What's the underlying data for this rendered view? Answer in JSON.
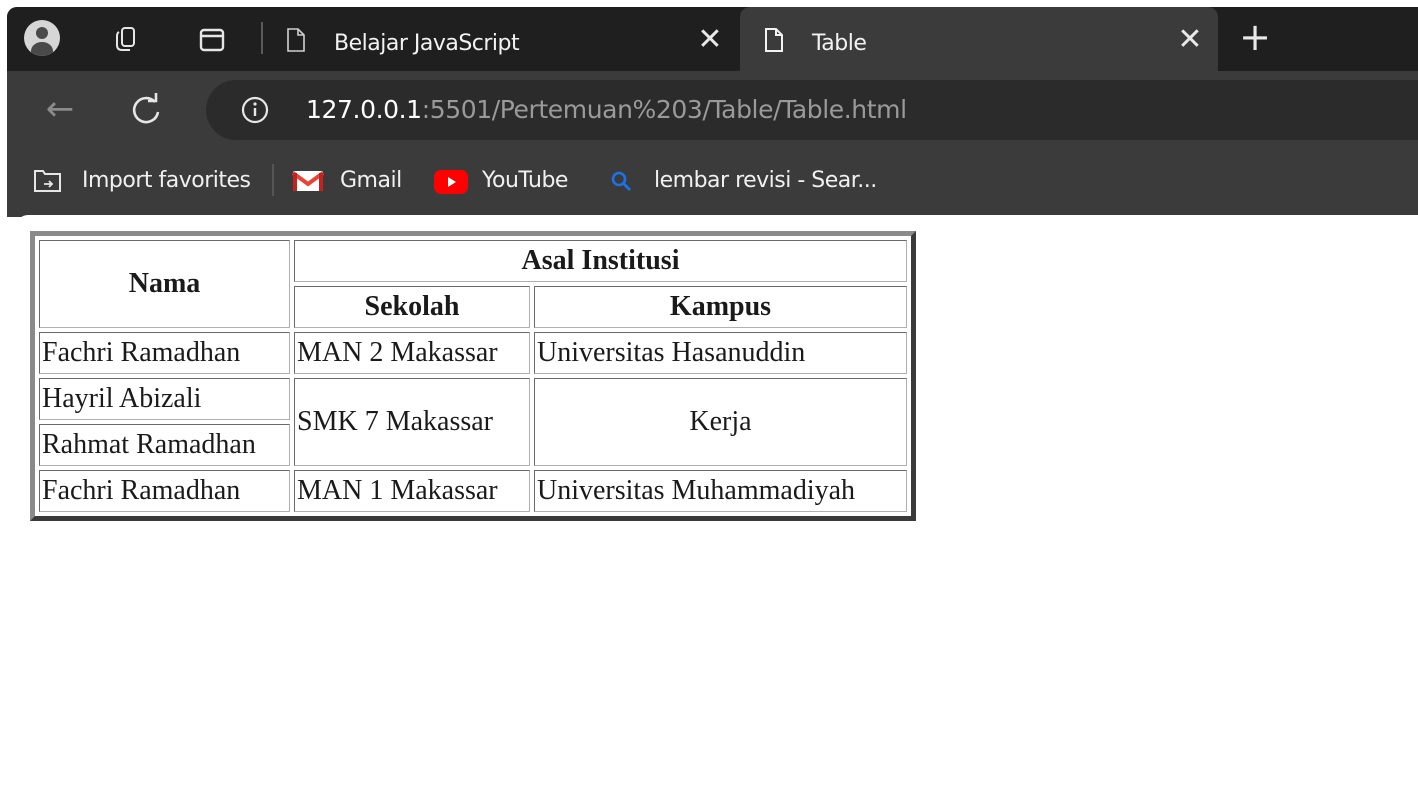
{
  "browser": {
    "tabs": [
      {
        "title": "Belajar JavaScript",
        "active": false
      },
      {
        "title": "Table",
        "active": true
      }
    ],
    "new_tab_symbol": "+",
    "close_symbol": "✕",
    "address": {
      "host": "127.0.0.1",
      "rest": ":5501/Pertemuan%203/Table/Table.html"
    },
    "favorites": [
      {
        "label": "Import favorites",
        "icon": "import-favorites-icon"
      },
      {
        "label": "Gmail",
        "icon": "gmail-icon"
      },
      {
        "label": "YouTube",
        "icon": "youtube-icon"
      },
      {
        "label": "lembar revisi - Sear...",
        "icon": "search-icon"
      }
    ],
    "colors": {
      "tabstrip": "#1f1f1f",
      "toolbar": "#3b3b3b",
      "address_bg": "#2b2b2b",
      "gmail_red": "#ea4335",
      "youtube_red": "#ff0000",
      "search_blue": "#1a73e8"
    }
  },
  "table": {
    "headers": {
      "nama": "Nama",
      "asal_institusi": "Asal Institusi",
      "sekolah": "Sekolah",
      "kampus": "Kampus"
    },
    "rows": [
      {
        "nama": "Fachri Ramadhan",
        "sekolah": "MAN 2 Makassar",
        "kampus": "Universitas Hasanuddin"
      },
      {
        "nama": "Hayril Abizali",
        "sekolah": "SMK 7 Makassar",
        "kampus": "Kerja"
      },
      {
        "nama": "Rahmat Ramadhan"
      },
      {
        "nama": "Fachri Ramadhan",
        "sekolah": "MAN 1 Makassar",
        "kampus": "Universitas Muhammadiyah"
      }
    ]
  }
}
